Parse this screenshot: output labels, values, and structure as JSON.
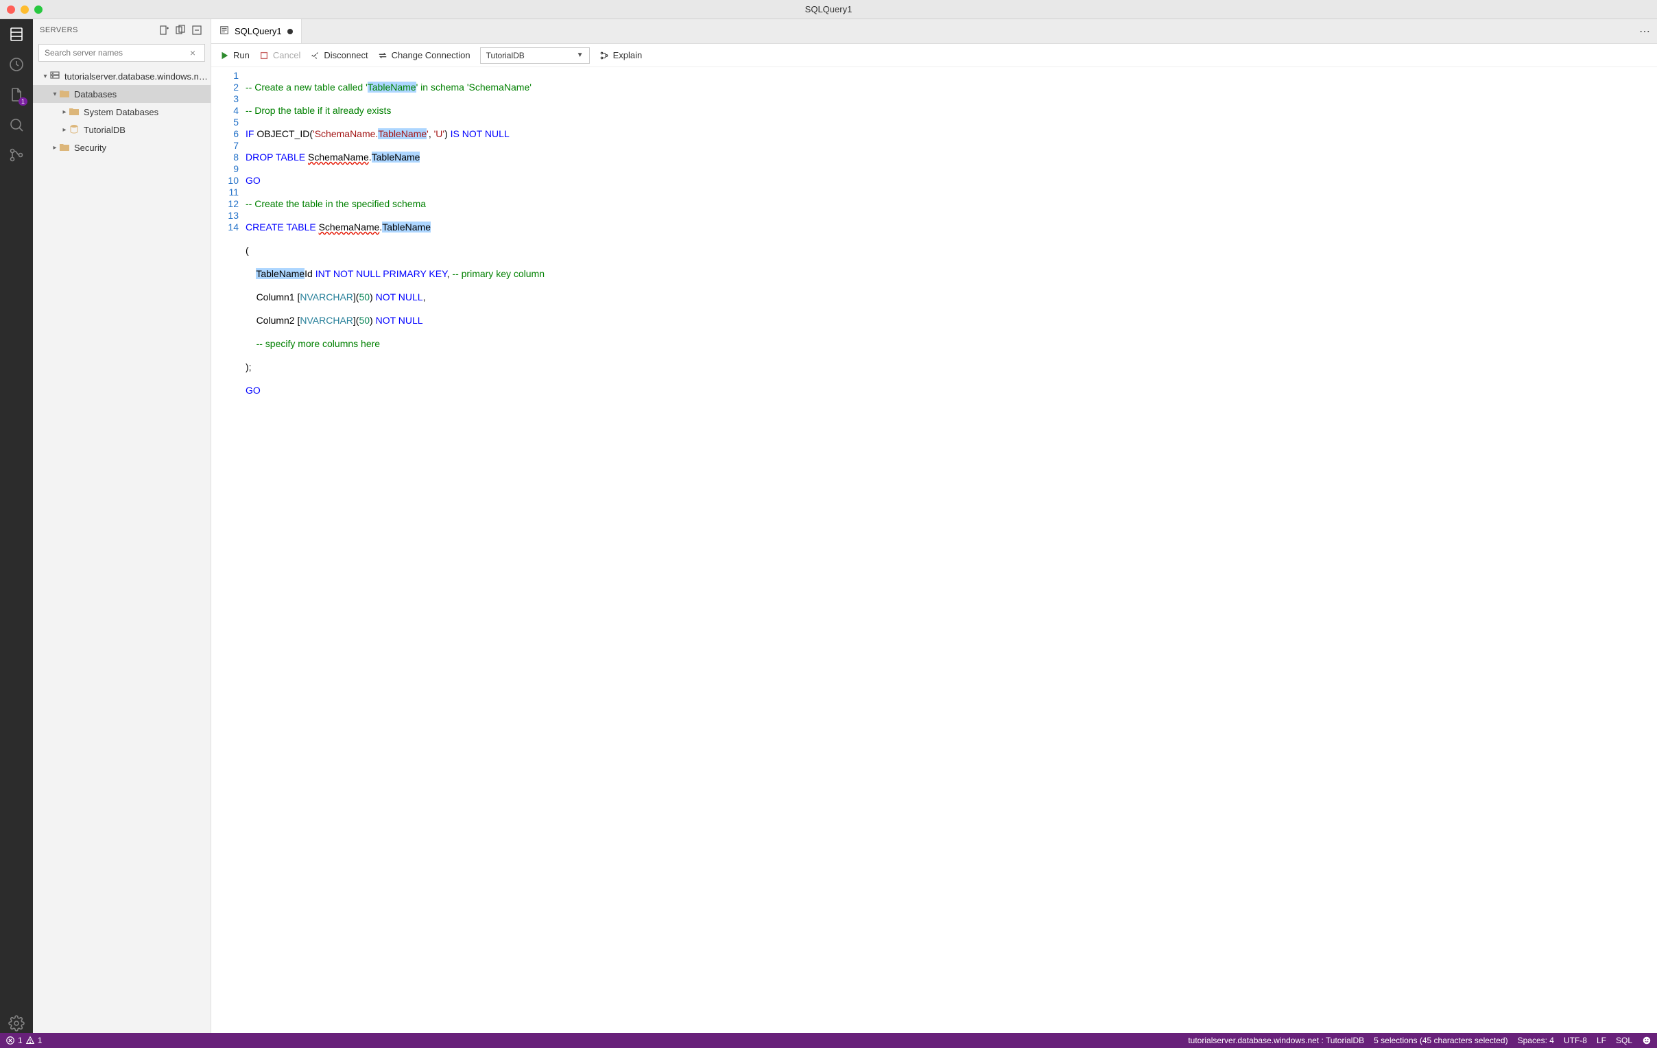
{
  "window": {
    "title": "SQLQuery1"
  },
  "activity": {
    "explorer_badge": "1"
  },
  "sidebar": {
    "title": "SERVERS",
    "search_placeholder": "Search server names",
    "tree": {
      "server": "tutorialserver.database.windows.n…",
      "databases": "Databases",
      "system_db": "System Databases",
      "tutorial_db": "TutorialDB",
      "security": "Security"
    }
  },
  "tab": {
    "label": "SQLQuery1"
  },
  "toolbar": {
    "run": "Run",
    "cancel": "Cancel",
    "disconnect": "Disconnect",
    "change_conn": "Change Connection",
    "db": "TutorialDB",
    "explain": "Explain"
  },
  "statusbar": {
    "errors": "1",
    "warnings": "1",
    "connection": "tutorialserver.database.windows.net : TutorialDB",
    "selection": "5 selections (45 characters selected)",
    "spaces": "Spaces: 4",
    "encoding": "UTF-8",
    "eol": "LF",
    "lang": "SQL"
  },
  "code": {
    "lines": 14
  }
}
